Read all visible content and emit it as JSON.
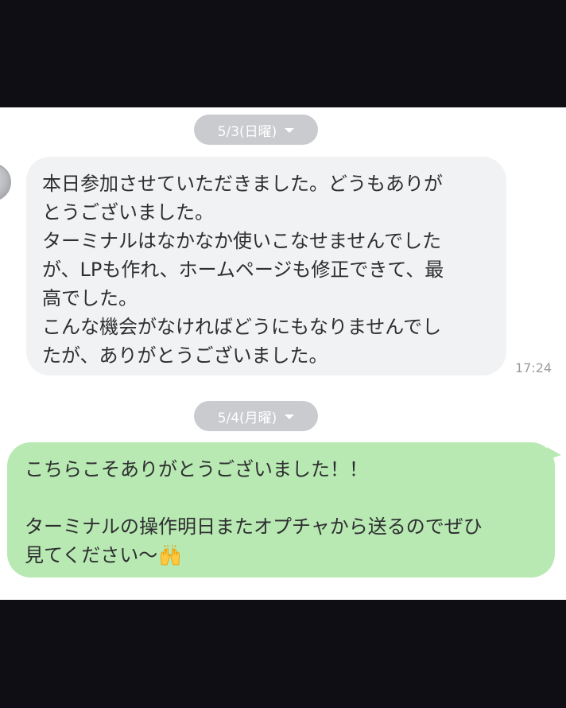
{
  "chat": {
    "dates": [
      {
        "label": "5/3(日曜)"
      },
      {
        "label": "5/4(月曜)"
      }
    ],
    "incoming": {
      "lines": [
        "本日参加させていただきました。どうもありが",
        "とうございました。",
        "ターミナルはなかなか使いこなせませんでした",
        "が、LPも作れ、ホームページも修正できて、最",
        "高でした。",
        "こんな機会がなければどうにもなりませんでし",
        "たが、ありがとうございました。"
      ],
      "time": "17:24"
    },
    "outgoing": {
      "lines": [
        "こちらこそありがとうございました！！",
        "",
        "ターミナルの操作明日またオプチャから送るのでぜひ",
        "見てください〜"
      ],
      "emoji": "raising-hands-icon"
    }
  },
  "colors": {
    "frame": "#0f0e14",
    "incoming_bubble": "#f1f2f4",
    "outgoing_bubble": "#b8e9b3",
    "date_pill": "#c9cbce"
  }
}
